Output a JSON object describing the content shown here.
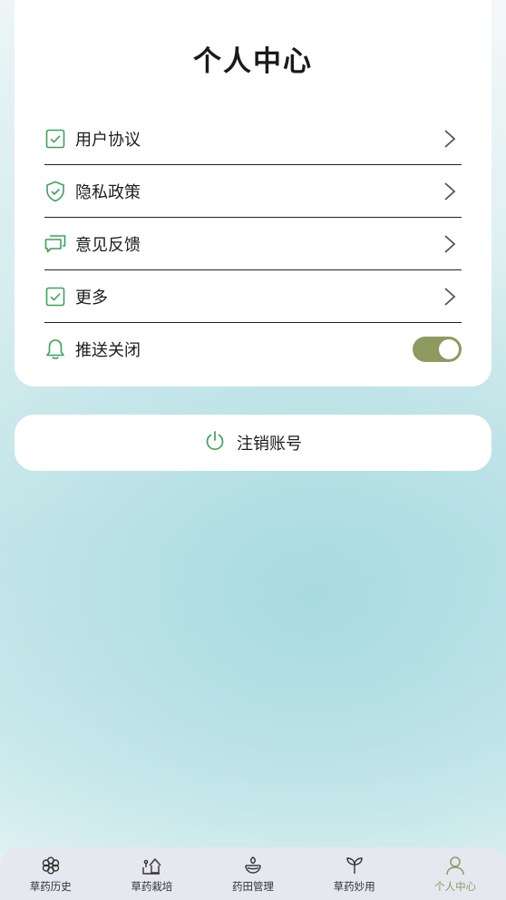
{
  "header": {
    "title": "个人中心"
  },
  "menu": {
    "items": [
      {
        "label": "用户协议",
        "icon": "checkbox-icon"
      },
      {
        "label": "隐私政策",
        "icon": "shield-check-icon"
      },
      {
        "label": "意见反馈",
        "icon": "chat-bubbles-icon"
      },
      {
        "label": "更多",
        "icon": "checkbox-icon"
      }
    ],
    "push": {
      "label": "推送关闭",
      "icon": "bell-icon",
      "enabled": true
    }
  },
  "logout": {
    "label": "注销账号",
    "icon": "power-icon"
  },
  "tabbar": {
    "items": [
      {
        "label": "草药历史",
        "icon": "flower-icon"
      },
      {
        "label": "草药栽培",
        "icon": "plant-pot-icon"
      },
      {
        "label": "药田管理",
        "icon": "field-bowl-icon"
      },
      {
        "label": "草药妙用",
        "icon": "sprout-icon"
      },
      {
        "label": "个人中心",
        "icon": "person-icon",
        "active": true
      }
    ]
  },
  "colors": {
    "accent": "#8e9a5e",
    "icon_green": "#3aa35a",
    "tab_bg": "#e6e7ef"
  }
}
